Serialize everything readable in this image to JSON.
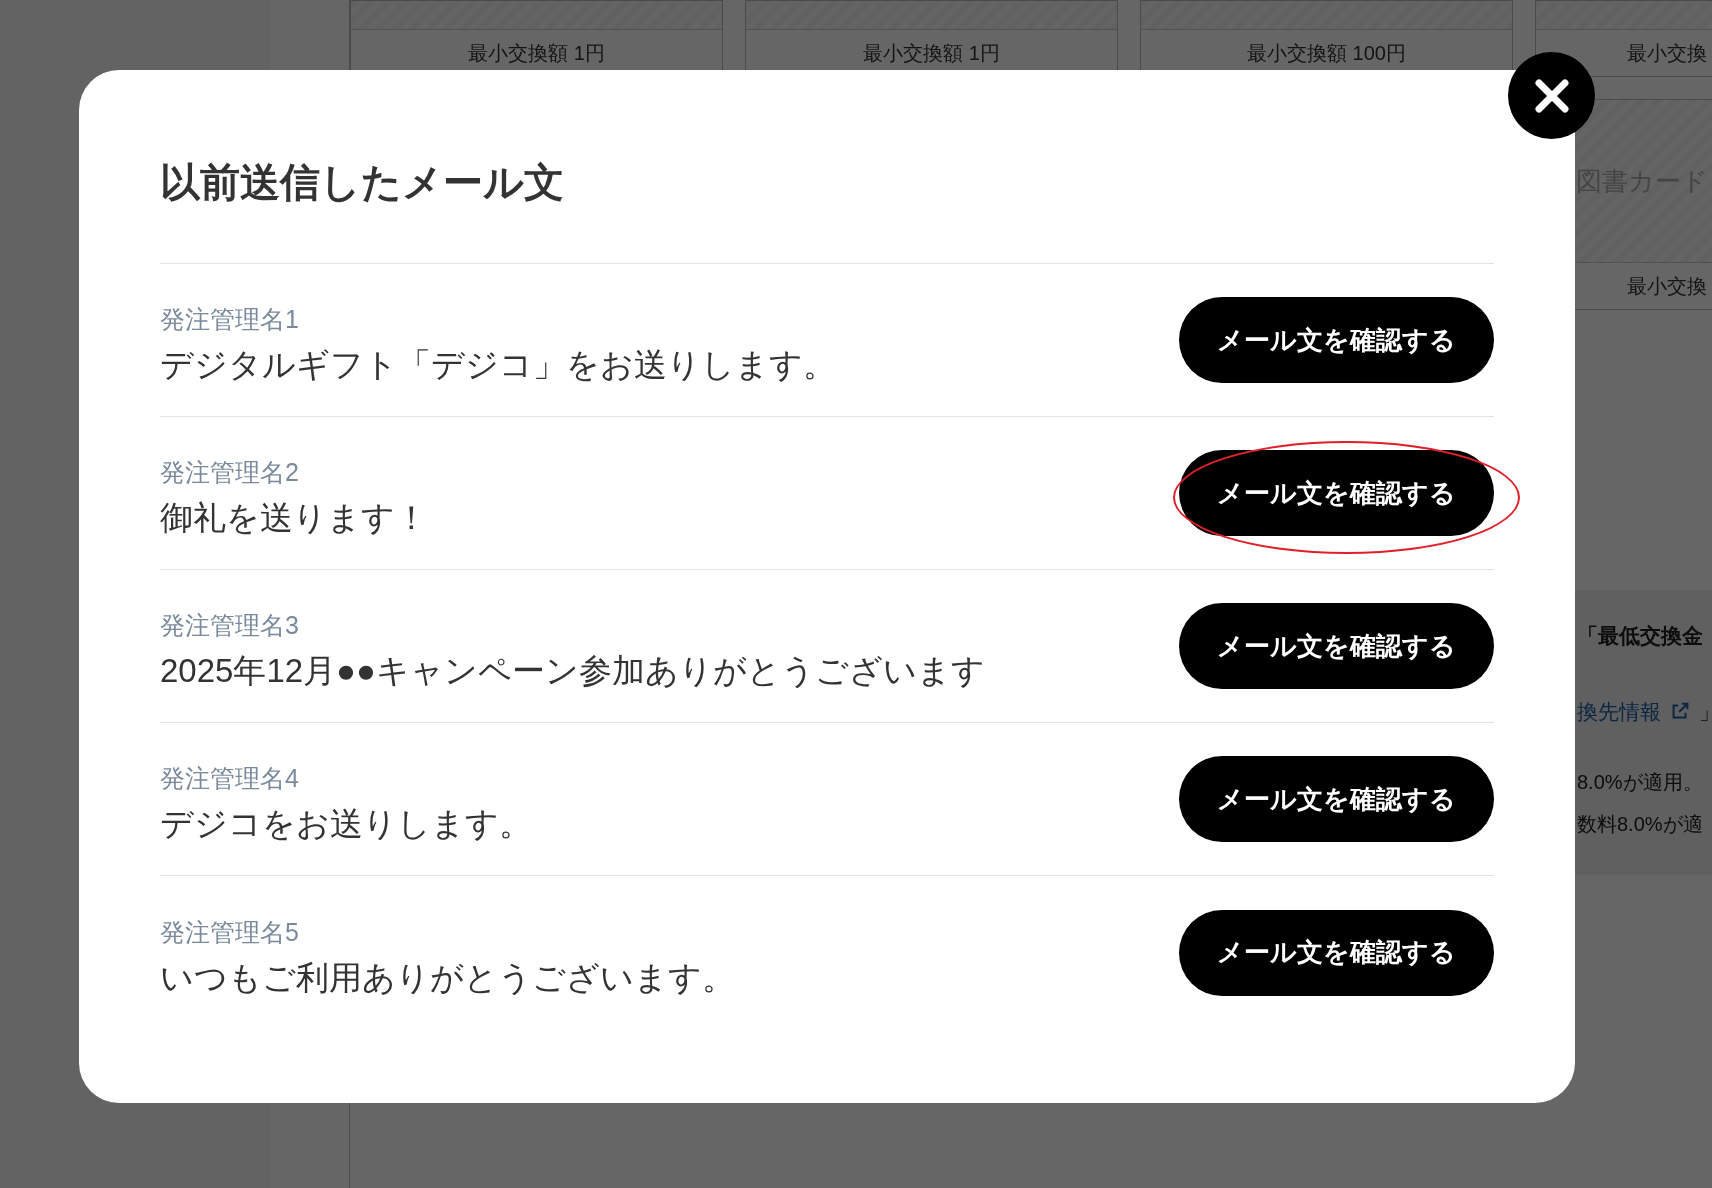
{
  "background": {
    "cards": [
      {
        "min_amount": "最小交換額 1円"
      },
      {
        "min_amount": "最小交換額 1円"
      },
      {
        "min_amount": "最小交換額 100円"
      }
    ],
    "side_card": {
      "top_amount": "最小交換",
      "name": "図書カード",
      "min_amount": "最小交換"
    },
    "notice": {
      "heading": "「最低交換金",
      "link": "換先情報",
      "link_suffix": "」",
      "lines": [
        "8.0%が適用。",
        "数料8.0%が適"
      ]
    }
  },
  "dialog": {
    "title": "以前送信したメール文",
    "items": [
      {
        "label": "発注管理名1",
        "subject": "デジタルギフト「デジコ」をお送りします。",
        "button": "メール文を確認する",
        "highlighted": false
      },
      {
        "label": "発注管理名2",
        "subject": "御礼を送ります！",
        "button": "メール文を確認する",
        "highlighted": true
      },
      {
        "label": "発注管理名3",
        "subject": "2025年12月●●キャンペーン参加ありがとうございます",
        "button": "メール文を確認する",
        "highlighted": false
      },
      {
        "label": "発注管理名4",
        "subject": "デジコをお送りします。",
        "button": "メール文を確認する",
        "highlighted": false
      },
      {
        "label": "発注管理名5",
        "subject": "いつもご利用ありがとうございます。",
        "button": "メール文を確認する",
        "highlighted": false
      }
    ]
  }
}
